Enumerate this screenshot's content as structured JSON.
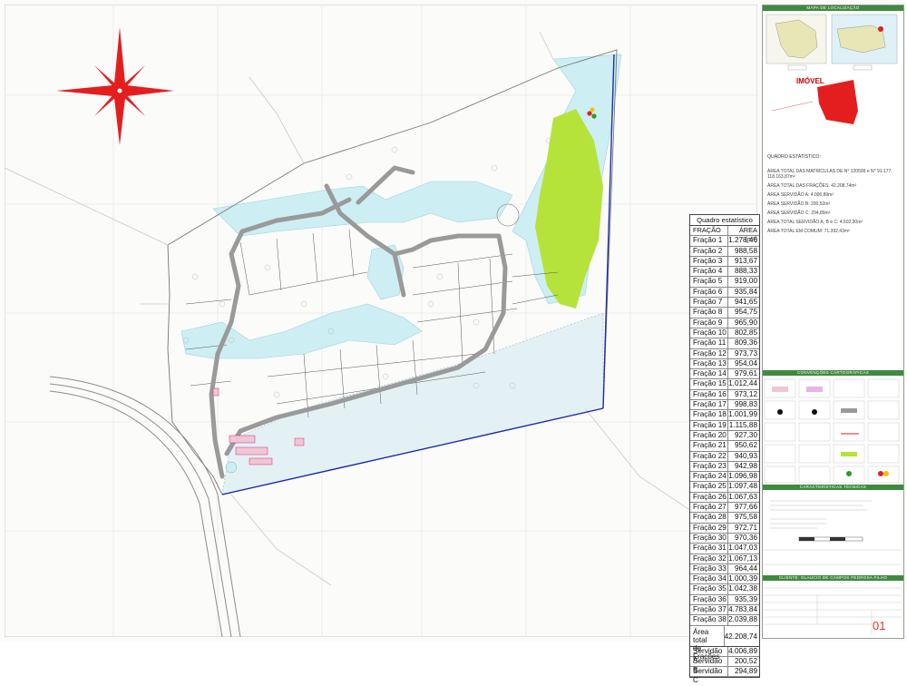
{
  "quadro": {
    "title": "Quadro estatístico",
    "col_fracao": "FRAÇÃO",
    "col_area": "ÁREA (m²)",
    "rows": [
      {
        "f": "Fração 1",
        "a": "1.278,46"
      },
      {
        "f": "Fração 2",
        "a": "988,58"
      },
      {
        "f": "Fração 3",
        "a": "913,67"
      },
      {
        "f": "Fração 4",
        "a": "888,33"
      },
      {
        "f": "Fração 5",
        "a": "919,00"
      },
      {
        "f": "Fração 6",
        "a": "935,84"
      },
      {
        "f": "Fração 7",
        "a": "941,65"
      },
      {
        "f": "Fração 8",
        "a": "954,75"
      },
      {
        "f": "Fração 9",
        "a": "965,90"
      },
      {
        "f": "Fração 10",
        "a": "802,85"
      },
      {
        "f": "Fração 11",
        "a": "809,36"
      },
      {
        "f": "Fração 12",
        "a": "973,73"
      },
      {
        "f": "Fração 13",
        "a": "954,04"
      },
      {
        "f": "Fração 14",
        "a": "979,61"
      },
      {
        "f": "Fração 15",
        "a": "1.012,44"
      },
      {
        "f": "Fração 16",
        "a": "973,12"
      },
      {
        "f": "Fração 17",
        "a": "998,83"
      },
      {
        "f": "Fração 18",
        "a": "1.001,99"
      },
      {
        "f": "Fração 19",
        "a": "1.115,88"
      },
      {
        "f": "Fração 20",
        "a": "927,30"
      },
      {
        "f": "Fração 21",
        "a": "950,62"
      },
      {
        "f": "Fração 22",
        "a": "940,93"
      },
      {
        "f": "Fração 23",
        "a": "942,98"
      },
      {
        "f": "Fração 24",
        "a": "1.096,98"
      },
      {
        "f": "Fração 25",
        "a": "1.097,48"
      },
      {
        "f": "Fração 26",
        "a": "1.067,63"
      },
      {
        "f": "Fração 27",
        "a": "977,66"
      },
      {
        "f": "Fração 28",
        "a": "975,58"
      },
      {
        "f": "Fração 29",
        "a": "972,71"
      },
      {
        "f": "Fração 30",
        "a": "970,36"
      },
      {
        "f": "Fração 31",
        "a": "1.047,03"
      },
      {
        "f": "Fração 32",
        "a": "1.067,13"
      },
      {
        "f": "Fração 33",
        "a": "964,44"
      },
      {
        "f": "Fração 34",
        "a": "1.000,39"
      },
      {
        "f": "Fração 35",
        "a": "1.042,38"
      },
      {
        "f": "Fração 36",
        "a": "935,39"
      },
      {
        "f": "Fração 37",
        "a": "4.783,84"
      },
      {
        "f": "Fração 38",
        "a": "2.039,88"
      }
    ],
    "total_label_1": "Área total",
    "total_label_2": "de Frações",
    "total_value": "42.208,74",
    "servidoes": [
      {
        "f": "Servidão A",
        "a": "4.006,89"
      },
      {
        "f": "Servidão B",
        "a": "200,52"
      },
      {
        "f": "Servidão C",
        "a": "294,89"
      }
    ]
  },
  "panel": {
    "loc_title": "MAPA DE LOCALIZAÇÃO",
    "imovel": "IMÓVEL",
    "estat_title": "QUADRO ESTATÍSTICO:",
    "estat_lines": [
      "ÁREA TOTAL DAS MATRÍCULAS  DE N° 120599 e N° 91.177: 118.163,87m²",
      "ÁREA TOTAL DAS FRAÇÕES: 42.208,74m²",
      "ÁREA SERVIDÃO A: 4.006,89m²",
      "ÁREA SERVIDÃO B: 200,52m²",
      "ÁREA SERVIDÃO C: 294,89m²",
      "ÁREA TOTAL SERVIDÃO A, B e C: 4.502,30m²",
      "ÁREA TOTAL EM COMUM: 71.392,43m²"
    ],
    "conv_title": "CONVENÇÕES CARTOGRÁFICAS",
    "tec_title": "CARACTERÍSTICAS TÉCNICAS",
    "cliente_title": "CLIENTE: GLAUCIO DE CAMPOS PEDROSA FILHO",
    "sheet_number": "01"
  },
  "colors": {
    "red": "#e41e1e",
    "green_area": "#b5e33a",
    "water": "#cdeef3",
    "road": "#9a9a9a",
    "blue_line": "#1c2fa8",
    "panel_green": "#3e8a3e"
  }
}
